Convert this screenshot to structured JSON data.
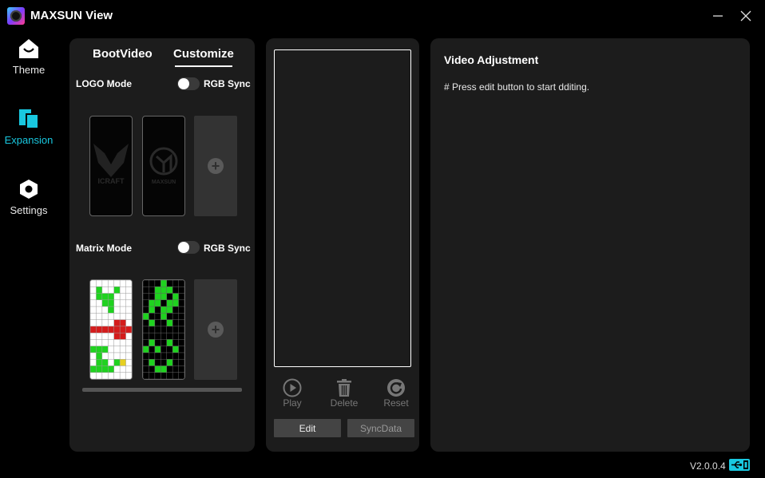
{
  "app": {
    "title": "MAXSUN View",
    "version": "V2.0.0.4"
  },
  "window": {
    "minimize_icon": "minus-icon",
    "close_icon": "x-icon"
  },
  "sidebar": {
    "items": [
      {
        "label": "Theme",
        "icon": "theme-icon",
        "active": false
      },
      {
        "label": "Expansion",
        "icon": "expansion-icon",
        "active": true
      },
      {
        "label": "Settings",
        "icon": "settings-icon",
        "active": false
      }
    ]
  },
  "left_panel": {
    "tabs": [
      {
        "label": "BootVideo",
        "active": false
      },
      {
        "label": "Customize",
        "active": true
      }
    ],
    "logo_mode": {
      "label": "LOGO Mode",
      "rgb_sync_label": "RGB Sync",
      "rgb_sync_on": false,
      "thumbnails": [
        {
          "name": "ICRAFT",
          "icon": "icraft-logo"
        },
        {
          "name": "MAXSUN",
          "icon": "maxsun-logo"
        }
      ]
    },
    "matrix_mode": {
      "label": "Matrix Mode",
      "rgb_sync_label": "RGB Sync",
      "rgb_sync_on": false,
      "thumbnails": [
        {
          "icon": "matrix-pattern-1"
        },
        {
          "icon": "matrix-pattern-2"
        }
      ]
    },
    "add_icon": "plus-circle-icon"
  },
  "middle_panel": {
    "controls": [
      {
        "label": "Play",
        "icon": "play-icon"
      },
      {
        "label": "Delete",
        "icon": "trash-icon"
      },
      {
        "label": "Reset",
        "icon": "reset-icon"
      }
    ],
    "edit_label": "Edit",
    "syncdata_label": "SyncData"
  },
  "right_panel": {
    "title": "Video Adjustment",
    "message": "# Press edit button to start dditing."
  },
  "colors": {
    "accent": "#19c8e0",
    "panel": "#1c1c1c",
    "background": "#000000"
  }
}
